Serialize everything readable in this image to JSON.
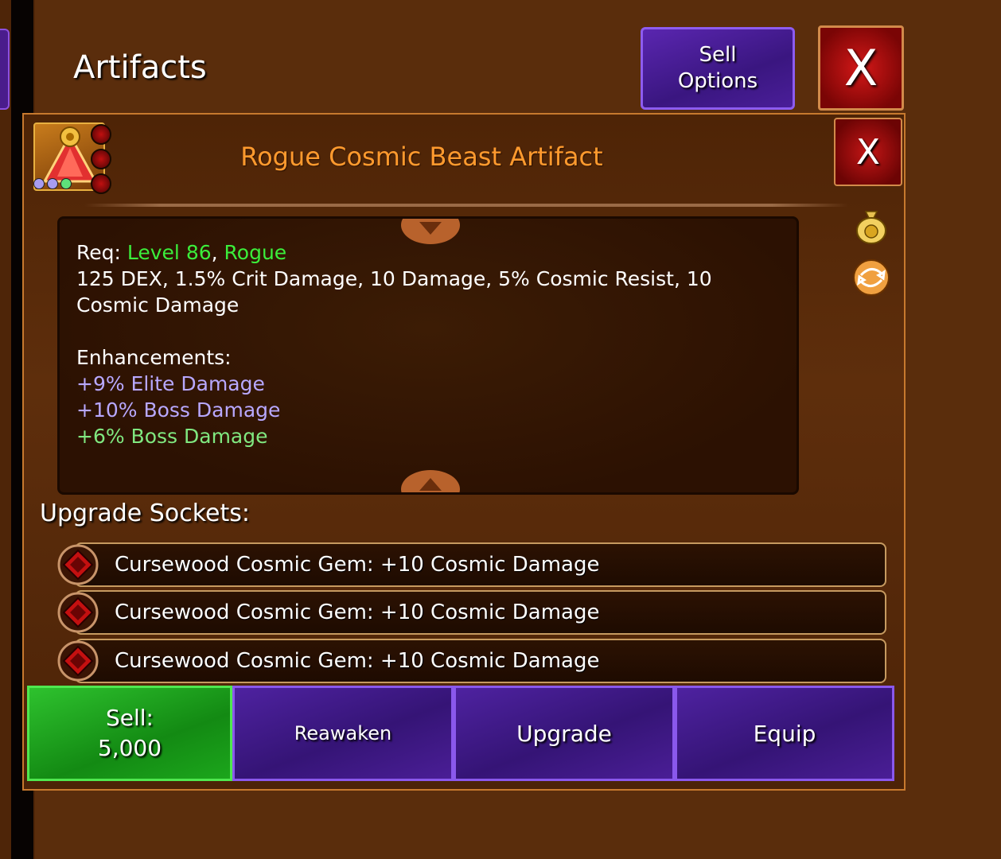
{
  "header": {
    "title": "Artifacts",
    "sell_options_label": "Sell\nOptions",
    "close_label": "X"
  },
  "dialog": {
    "item_title": "Rogue Cosmic Beast Artifact",
    "close_label": "X",
    "details": {
      "req_label": "Req:",
      "req_level": "Level 86",
      "req_separator": ",",
      "req_class": "Rogue",
      "stats": "125 DEX, 1.5% Crit Damage, 10 Damage, 5% Cosmic Resist, 10 Cosmic Damage",
      "enhancements_label": "Enhancements:",
      "enhancements": [
        {
          "text": "+9% Elite Damage",
          "color": "#b8a8ff"
        },
        {
          "text": "+10% Boss Damage",
          "color": "#b8a8ff"
        },
        {
          "text": "+6% Boss Damage",
          "color": "#80e880"
        }
      ]
    },
    "sockets_label": "Upgrade Sockets:",
    "sockets": [
      "Cursewood Cosmic Gem: +10 Cosmic Damage",
      "Cursewood Cosmic Gem: +10 Cosmic Damage",
      "Cursewood Cosmic Gem: +10 Cosmic Damage"
    ],
    "buttons": {
      "sell_label": "Sell:",
      "sell_price": "5,000",
      "reawaken": "Reawaken",
      "upgrade": "Upgrade",
      "equip": "Equip"
    }
  },
  "colors": {
    "title_orange": "#ff9a2e",
    "req_green": "#3bee3b",
    "enhancement_purple": "#b8a8ff",
    "enhancement_green": "#80e880",
    "button_purple": "#3a1680",
    "button_green": "#1ca61c"
  },
  "icons": [
    "artifact-item-icon",
    "gold-bag-icon",
    "swap-icon",
    "scroll-down-icon",
    "scroll-up-icon",
    "socket-gem-icon"
  ]
}
